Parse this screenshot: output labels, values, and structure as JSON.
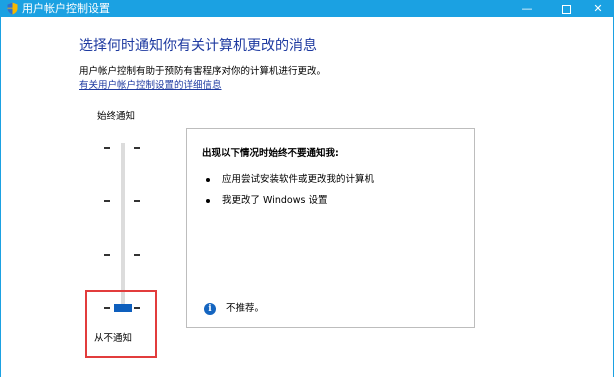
{
  "window": {
    "title": "用户帐户控制设置",
    "controls": {
      "minimize": "—",
      "close": "✕"
    }
  },
  "main": {
    "heading": "选择何时通知你有关计算机更改的消息",
    "description": "用户帐户控制有助于预防有害程序对你的计算机进行更改。",
    "link": "有关用户帐户控制设置的详细信息"
  },
  "slider": {
    "top_label": "始终通知",
    "bottom_label": "从不通知",
    "levels": 4,
    "selected_level": 1
  },
  "panel": {
    "title": "出现以下情况时始终不要通知我:",
    "items": [
      "应用尝试安装软件或更改我的计算机",
      "我更改了 Windows 设置"
    ],
    "info_icon": "i",
    "note": "不推荐。"
  },
  "colors": {
    "titlebar": "#1ba1e2",
    "heading": "#1e3aa0",
    "thumb": "#0e5fbd",
    "highlight": "#e23c3c"
  }
}
